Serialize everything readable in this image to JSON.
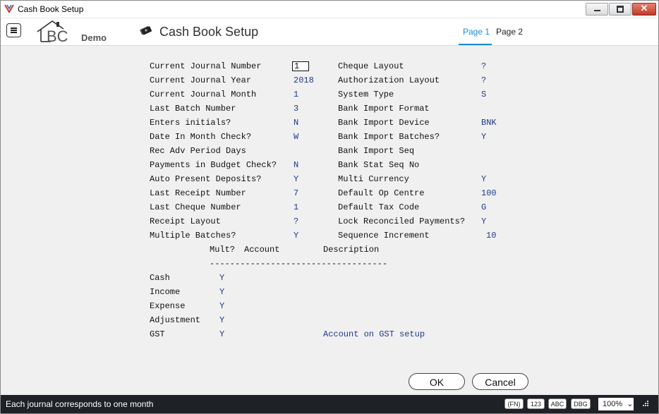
{
  "window": {
    "title": "Cash Book Setup",
    "close_glyph": "✕"
  },
  "header": {
    "logo_text": "BC",
    "logo_suffix": "Demo",
    "title": "Cash Book Setup",
    "tabs": [
      {
        "label": "Page 1",
        "active": true
      },
      {
        "label": "Page 2",
        "active": false
      }
    ],
    "icons": [
      "menu-icon",
      "logo-house-icon",
      "cash-book-icon"
    ]
  },
  "form": {
    "left_fields": [
      {
        "label": "Current Journal Number",
        "value": "1"
      },
      {
        "label": "Current Journal Year",
        "value": "2018"
      },
      {
        "label": "Current Journal Month",
        "value": "1"
      },
      {
        "label": "Last Batch Number",
        "value": "3"
      },
      {
        "label": "Enters initials?",
        "value": "N"
      },
      {
        "label": "Date In Month Check?",
        "value": "W"
      },
      {
        "label": "Rec Adv Period Days",
        "value": ""
      },
      {
        "label": "Payments in Budget Check?",
        "value": "N"
      },
      {
        "label": "Auto Present Deposits?",
        "value": "Y"
      },
      {
        "label": "Last Receipt Number",
        "value": "7"
      },
      {
        "label": "Last Cheque Number",
        "value": "1"
      },
      {
        "label": "Receipt Layout",
        "value": "?"
      },
      {
        "label": "Multiple Batches?",
        "value": "Y"
      }
    ],
    "right_fields": [
      {
        "label": "Cheque Layout",
        "value": "?"
      },
      {
        "label": "Authorization Layout",
        "value": "?"
      },
      {
        "label": "System Type",
        "value": "S"
      },
      {
        "label": "Bank Import Format",
        "value": ""
      },
      {
        "label": "Bank Import Device",
        "value": "BNK"
      },
      {
        "label": "Bank Import Batches?",
        "value": "Y"
      },
      {
        "label": "Bank Import Seq",
        "value": ""
      },
      {
        "label": "Bank Stat Seq No",
        "value": ""
      },
      {
        "label": "Multi Currency",
        "value": "Y"
      },
      {
        "label": "Default Op Centre",
        "value": "100"
      },
      {
        "label": "Default Tax Code",
        "value": "G"
      },
      {
        "label": "Lock Reconciled Payments?",
        "value": "Y"
      },
      {
        "label": "Sequence Increment",
        "value": "10"
      }
    ],
    "account_table": {
      "headers": {
        "mult": "Mult?",
        "account": "Account",
        "description": "Description"
      },
      "separator": "-----------------------------------",
      "rows": [
        {
          "type": "Cash",
          "mult": "Y",
          "description": ""
        },
        {
          "type": "Income",
          "mult": "Y",
          "description": ""
        },
        {
          "type": "Expense",
          "mult": "Y",
          "description": ""
        },
        {
          "type": "Adjustment",
          "mult": "Y",
          "description": ""
        },
        {
          "type": "GST",
          "mult": "Y",
          "description": "Account on GST setup"
        }
      ]
    }
  },
  "buttons": {
    "ok": "OK",
    "cancel": "Cancel"
  },
  "statusbar": {
    "message": "Each journal corresponds to one month",
    "badges": [
      "(FN)",
      "123",
      "ABC",
      "DBG"
    ],
    "zoom": "100%",
    "zoom_caret": "⌄"
  },
  "colors": {
    "value_text": "#1f3a8a",
    "accent": "#1a8bd4",
    "content_bg": "#f0f0f0",
    "statusbar_bg": "#1e2126"
  }
}
